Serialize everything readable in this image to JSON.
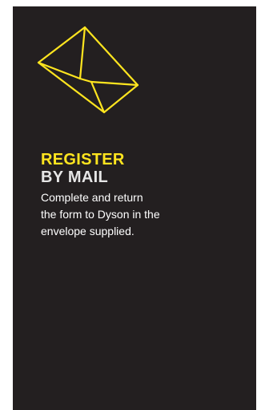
{
  "colors": {
    "background": "#231f20",
    "accent": "#ffe51f",
    "heading": "#e6e6e6",
    "text": "#ffffff"
  },
  "icon": "envelope-icon",
  "heading": {
    "line1": "REGISTER",
    "line2": "BY MAIL"
  },
  "body": {
    "lines": [
      "Complete and return",
      "the form to Dyson in the",
      "envelope supplied."
    ]
  }
}
